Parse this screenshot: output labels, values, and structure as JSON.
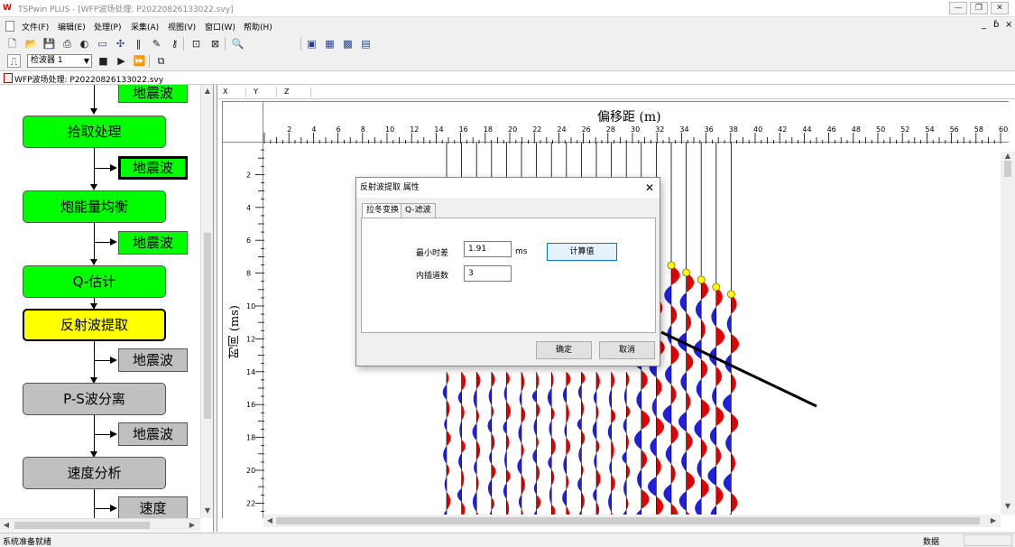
{
  "window": {
    "app_name": "TSPwin PLUS",
    "doc_title": "[WFP波场处理: P20220826133022.svy]",
    "controls": {
      "minimize": "—",
      "restore": "❐",
      "close": "✕"
    }
  },
  "menu": {
    "items": [
      "文件(F)",
      "编辑(E)",
      "处理(P)",
      "采集(A)",
      "视图(V)",
      "窗口(W)",
      "帮助(H)"
    ],
    "mdi_controls": [
      "_",
      "ɓ",
      "×"
    ]
  },
  "toolbar": {
    "detector_select": "检波器 1"
  },
  "document_tab": {
    "title": "WFP波场处理: P20220826133022.svy"
  },
  "flow": {
    "top_data": "地震波",
    "steps": [
      {
        "label": "拾取处理",
        "data": "地震波",
        "color": "green"
      },
      {
        "label": "炮能量均衡",
        "data": "地震波",
        "color": "green"
      },
      {
        "label": "Q-估计",
        "data": "",
        "color": "green"
      },
      {
        "label": "反射波提取",
        "data": "地震波",
        "color": "yellow"
      },
      {
        "label": "P-S波分离",
        "data": "地震波",
        "color": "gray"
      },
      {
        "label": "速度分析",
        "data": "速度",
        "color": "gray"
      }
    ]
  },
  "seismic": {
    "coord_labels": [
      "X",
      "Y",
      "Z"
    ],
    "x_axis_title": "偏移距 (m)",
    "y_axis_title": "时间 (ms)",
    "x_ticks": [
      "2",
      "4",
      "6",
      "8",
      "10",
      "12",
      "14",
      "16",
      "18",
      "20",
      "22",
      "24",
      "26",
      "28",
      "30",
      "32",
      "34",
      "36",
      "38",
      "40",
      "42",
      "44",
      "46",
      "48",
      "50",
      "52",
      "54",
      "56",
      "58",
      "60"
    ],
    "y_ticks": [
      "2",
      "4",
      "6",
      "8",
      "10",
      "12",
      "14",
      "16",
      "18",
      "20",
      "22"
    ],
    "colors": {
      "positive": "#e00000",
      "negative": "#1f1fe0",
      "picks": "#ffff00",
      "line": "#000000"
    }
  },
  "dialog": {
    "title": "反射波提取 属性",
    "close": "✕",
    "tabs": [
      "拉冬变换",
      "Q-滤波"
    ],
    "min_time_diff_label": "最小时差",
    "min_time_diff_value": "1.91",
    "min_time_diff_unit": "ms",
    "compute_button": "计算值",
    "interp_label": "内插道数",
    "interp_value": "3",
    "ok_button": "确定",
    "cancel_button": "取消"
  },
  "status": {
    "left": "系统准备就绪",
    "right": "数据"
  }
}
